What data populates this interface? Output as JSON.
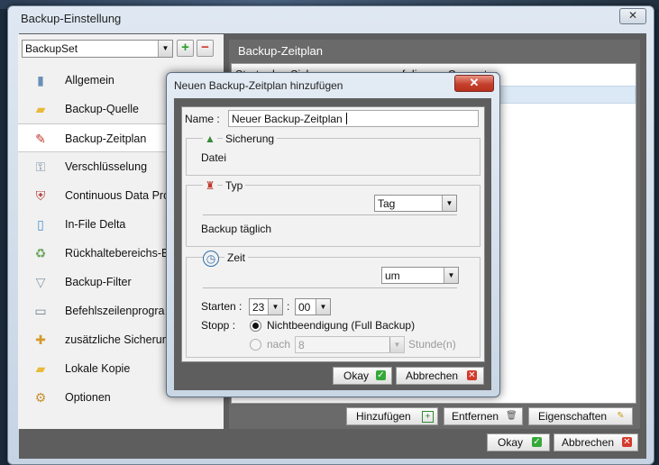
{
  "window": {
    "title": "Backup-Einstellung",
    "close_glyph": "✕"
  },
  "left_panel": {
    "backup_set": "BackupSet",
    "add_glyph": "+",
    "remove_glyph": "−",
    "items": [
      {
        "label": "Allgemein",
        "icon": "general-icon",
        "glyph": "▮",
        "color": "#6a8fb8"
      },
      {
        "label": "Backup-Quelle",
        "icon": "folder-icon",
        "glyph": "▰",
        "color": "#e8b93a"
      },
      {
        "label": "Backup-Zeitplan",
        "icon": "schedule-icon",
        "glyph": "✎",
        "color": "#c0392b"
      },
      {
        "label": "Verschlüsselung",
        "icon": "key-icon",
        "glyph": "⚿",
        "color": "#7d8fa3"
      },
      {
        "label": "Continuous Data Pro",
        "icon": "shield-icon",
        "glyph": "⛨",
        "color": "#b33a3a"
      },
      {
        "label": "In-File Delta",
        "icon": "document-icon",
        "glyph": "▯",
        "color": "#4f8fd0"
      },
      {
        "label": "Rückhaltebereichs-E",
        "icon": "recycle-bin-icon",
        "glyph": "♻",
        "color": "#6aa35a"
      },
      {
        "label": "Backup-Filter",
        "icon": "filter-icon",
        "glyph": "▽",
        "color": "#8a99a8"
      },
      {
        "label": "Befehlszeilenprogra",
        "icon": "command-line-icon",
        "glyph": "▭",
        "color": "#6f7f8f"
      },
      {
        "label": "zusätzliche Sicherun",
        "icon": "extra-backup-icon",
        "glyph": "✚",
        "color": "#d49a2a"
      },
      {
        "label": "Lokale Kopie",
        "icon": "local-copy-icon",
        "glyph": "▰",
        "color": "#e8b93a"
      },
      {
        "label": "Optionen",
        "icon": "options-icon",
        "glyph": "⚙",
        "color": "#c7902e"
      }
    ],
    "selected_index": 2
  },
  "right_panel": {
    "title": "Backup-Zeitplan",
    "top_line": "Starte den Sicherungsprozess auf diesem Computer",
    "buttons": {
      "add": "Hinzufügen",
      "remove": "Entfernen",
      "properties": "Eigenschaften"
    }
  },
  "footer": {
    "ok": "Okay",
    "cancel": "Abbrechen"
  },
  "dialog": {
    "title": "Neuen Backup-Zeitplan hinzufügen",
    "close_glyph": "✕",
    "name_label": "Name :",
    "name_value": "Neuer Backup-Zeitplan",
    "sicherung": {
      "title": "Sicherung",
      "value": "Datei"
    },
    "typ": {
      "title": "Typ",
      "selected": "Tag",
      "description": "Backup täglich"
    },
    "zeit": {
      "title": "Zeit",
      "mode": "um",
      "start_label": "Starten :",
      "hour": "23",
      "colon": ":",
      "minute": "00",
      "stop_label": "Stopp :",
      "option1": "Nichtbeendigung (Full Backup)",
      "option2_prefix": "nach",
      "option2_value": "8",
      "option2_unit": "Stunde(n)"
    },
    "ok": "Okay",
    "cancel": "Abbrechen"
  }
}
